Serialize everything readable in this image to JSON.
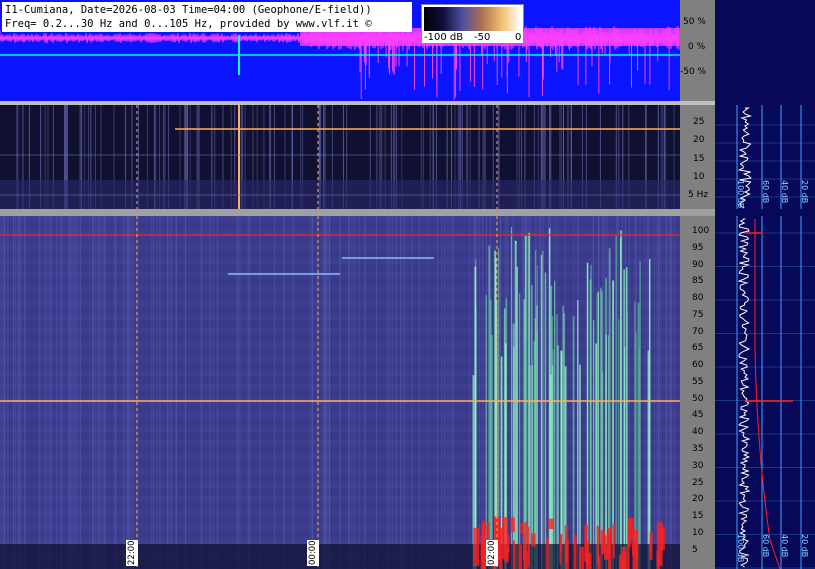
{
  "header": {
    "line1": "I1-Cumiana, Date=2026-08-03 Time=04:00 (Geophone/E-field))",
    "line2": "Freq= 0.2...30 Hz and 0...105 Hz, provided by www.vlf.it ©"
  },
  "colorbar": {
    "labels": [
      "-100 dB",
      "-50",
      "0"
    ]
  },
  "waveform_axis": {
    "labels": [
      "50 %",
      "0 %",
      "-50 %"
    ]
  },
  "spectrogram_low": {
    "unit_label": "Hz",
    "labels": [
      "25",
      "20",
      "15",
      "10",
      "5"
    ]
  },
  "spectrogram_high": {
    "labels": [
      "100",
      "95",
      "90",
      "85",
      "80",
      "75",
      "70",
      "65",
      "60",
      "55",
      "50",
      "45",
      "40",
      "35",
      "30",
      "25",
      "20",
      "15",
      "10",
      "5"
    ]
  },
  "time_markers": [
    "22:00",
    "00:00",
    "02:00"
  ],
  "profile_top_labels": [
    "100 dB",
    "60 dB",
    "40 dB",
    "20 dB"
  ],
  "profile_bottom_labels": [
    "100 dB",
    "60 dB",
    "40 dB",
    "20 dB"
  ],
  "colors": {
    "waveform_bg": "#0a14ff",
    "waveform_trace": "#ff40ff",
    "zero_line": "#00ffd0",
    "spectrogram_bg": "#3a3a8a",
    "profile_bg": "#080858",
    "red_line": "#ff2020",
    "marker_line": "#ffb060"
  }
}
